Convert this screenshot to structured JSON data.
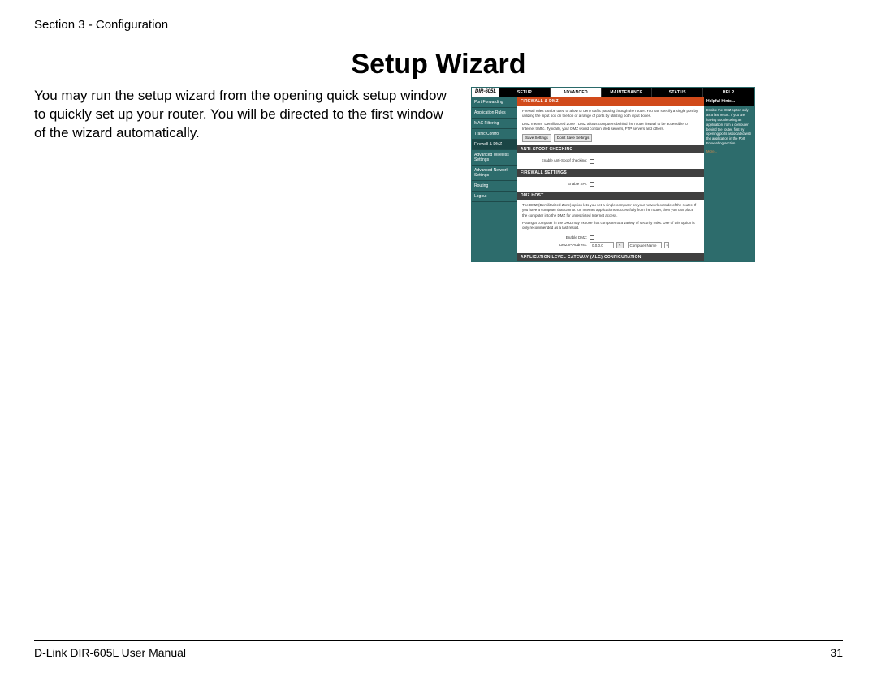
{
  "header": {
    "section": "Section 3 - Configuration"
  },
  "title": "Setup Wizard",
  "body": "You may run the setup wizard from the opening quick setup window to quickly set up your router. You will be directed to the first window of the wizard automatically.",
  "screenshot": {
    "logo": "DIR-605L",
    "tabs": [
      "SETUP",
      "ADVANCED",
      "MAINTENANCE",
      "STATUS",
      "HELP"
    ],
    "active_tab": 1,
    "sidebar": [
      "Port Forwarding",
      "Application Rules",
      "MAC Filtering",
      "Traffic Control",
      "Firewall & DMZ",
      "Advanced Wireless Settings",
      "Advanced Network Settings",
      "Routing",
      "Logout"
    ],
    "sidebar_active": 4,
    "sections": {
      "firewall_dmz": {
        "title": "FIREWALL & DMZ",
        "desc1": "Firewall rules can be used to allow or deny traffic passing through the router. You can specify a single port by utilizing the input box on the top or a range of ports by utilizing both input boxes.",
        "desc2": "DMZ means \"Demilitarized Zone\". DMZ allows computers behind the router firewall to be accessible to Internet traffic. Typically, your DMZ would contain Web servers, FTP servers and others.",
        "btn_save": "Save Settings",
        "btn_cancel": "Don't Save Settings"
      },
      "antispoof": {
        "title": "ANTI-SPOOF CHECKING",
        "label": "Enable Anti-Spoof checking:"
      },
      "firewall_settings": {
        "title": "FIREWALL SETTINGS",
        "label": "Enable SPI:"
      },
      "dmz_host": {
        "title": "DMZ HOST",
        "desc1": "The DMZ (Demilitarized Zone) option lets you set a single computer on your network outside of the router. If you have a computer that cannot run Internet applications successfully from the router, then you can place the computer into the DMZ for unrestricted Internet access.",
        "desc2": "Putting a computer in the DMZ may expose that computer to a variety of security risks. Use of this option is only recommended as a last resort.",
        "enable_label": "Enable DMZ:",
        "ip_label": "DMZ IP Address:",
        "ip_value": "0.0.0.0",
        "computer_btn": "Computer Name"
      },
      "alg": {
        "title": "APPLICATION LEVEL GATEWAY (ALG) CONFIGURATION"
      }
    },
    "help": {
      "title": "Helpful Hints...",
      "body": "Enable the DMZ option only as a last resort. If you are having trouble using an application from a computer behind the router, first try opening ports associated with the application in the Port Forwarding section.",
      "more": "More..."
    }
  },
  "footer": {
    "left": "D-Link DIR-605L User Manual",
    "right": "31"
  }
}
